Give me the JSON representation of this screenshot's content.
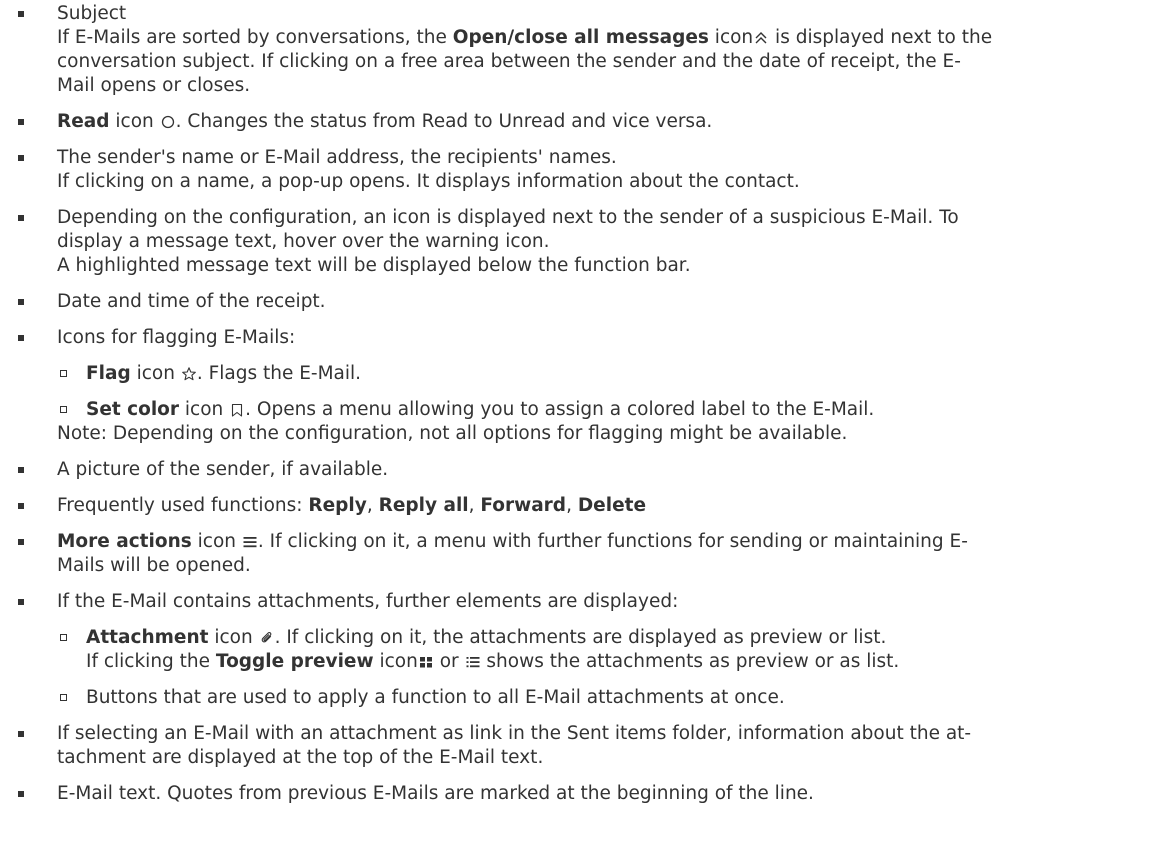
{
  "items": [
    {
      "line1": "Subject",
      "line2a": "If E-Mails are sorted by conversations, the ",
      "line2b": "Open/close all messages",
      "line2c": " icon",
      "line2d": " is displayed next to the",
      "line3": "conversation subject. If clicking on a free area between the sender and the date of receipt, the E-",
      "line4": "Mail opens or closes.",
      "icon": "double-chevron-up-icon"
    },
    {
      "a": "Read",
      "b": " icon ",
      "c": ". Changes the status from Read to Unread and vice versa.",
      "icon": "circle-outline-icon"
    },
    {
      "line1": "The sender's name or E-Mail address, the recipients' names.",
      "line2": "If clicking on a name, a pop-up opens. It displays information about the contact."
    },
    {
      "line1": "Depending on the configuration, an icon is displayed next to the sender of a suspicious E-Mail. To",
      "line2": "display a message text, hover over the warning icon.",
      "line3": "A highlighted message text will be displayed below the function bar."
    },
    {
      "line1": "Date and time of the receipt."
    },
    {
      "line1": "Icons for flagging E-Mails:",
      "sub": [
        {
          "a": "Flag",
          "b": " icon ",
          "c": ". Flags the E-Mail.",
          "icon": "star-outline-icon"
        },
        {
          "a": "Set color",
          "b": " icon ",
          "c": ". Opens a menu allowing you to assign a colored label to the E-Mail.",
          "icon": "bookmark-outline-icon"
        }
      ],
      "note": "Note: Depending on the configuration, not all options for flagging might be available."
    },
    {
      "line1": "A picture of the sender, if available."
    },
    {
      "pre": "Frequently used functions: ",
      "f1": "Reply",
      "sep1": ", ",
      "f2": "Reply all",
      "sep2": ", ",
      "f3": "Forward",
      "sep3": ", ",
      "f4": "Delete"
    },
    {
      "a": "More actions",
      "b": " icon ",
      "c": ". If clicking on it, a menu with further functions for sending or maintaining E-",
      "line2": "Mails will be opened.",
      "icon": "hamburger-icon"
    },
    {
      "line1": "If the E-Mail contains attachments, further elements are displayed:",
      "sub": [
        {
          "a": "Attachment",
          "b": " icon ",
          "c": ". If clicking on it, the attachments are displayed as preview or list.",
          "icon": "paperclip-icon",
          "l2a": "If clicking the ",
          "l2b": "Toggle preview",
          "l2c": " icon",
          "l2d": " or ",
          "l2e": " shows the attachments as preview or as list.",
          "icon2": "grid-icon",
          "icon3": "list-icon"
        },
        {
          "c": "Buttons that are used to apply a function to all E-Mail attachments at once."
        }
      ]
    },
    {
      "line1": "If selecting an E-Mail with an attachment as link in the Sent items folder, information about the at-",
      "line2": "tachment are displayed at the top of the E-Mail text."
    },
    {
      "line1": "E-Mail text. Quotes from previous E-Mails are marked at the beginning of the line."
    }
  ]
}
